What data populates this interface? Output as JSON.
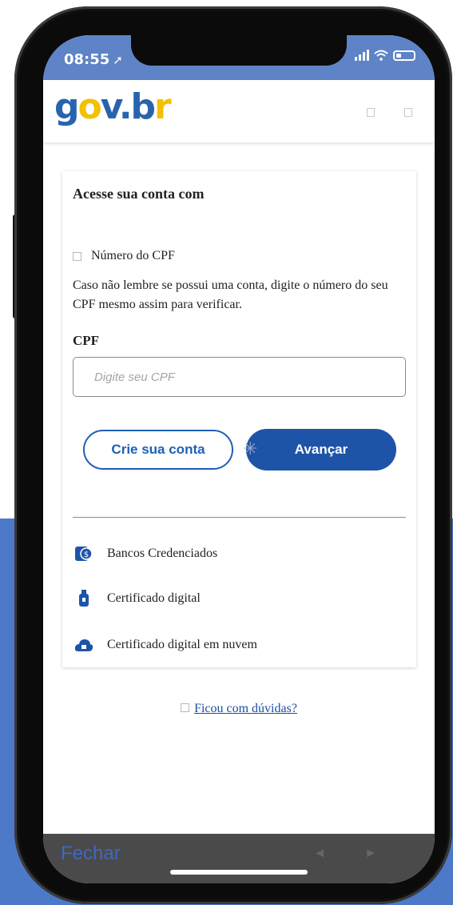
{
  "status_bar": {
    "time": "08:55",
    "location_arrow": "➚"
  },
  "header": {
    "logo_text": "gov.br",
    "icons": [
      "menu-icon",
      "profile-icon"
    ]
  },
  "card": {
    "title": "Acesse sua conta com",
    "option_cpf_label": "Número do CPF",
    "help_text": "Caso não lembre se possui uma conta, digite o número do seu CPF mesmo assim para verificar.",
    "cpf_label": "CPF",
    "cpf_placeholder": "Digite seu CPF",
    "create_button": "Crie sua conta",
    "next_button": "Avançar",
    "other_options": [
      {
        "label": "Bancos Credenciados",
        "icon": "bank-icon"
      },
      {
        "label": "Certificado digital",
        "icon": "usb-token-icon"
      },
      {
        "label": "Certificado digital em nuvem",
        "icon": "cloud-icon"
      }
    ]
  },
  "help": {
    "link_text": "Ficou com dúvidas?"
  },
  "bottom_bar": {
    "close_label": "Fechar",
    "back_arrow": "◄",
    "forward_arrow": "►"
  },
  "colors": {
    "primary": "#1d54a8",
    "status_bar": "#5e83c6",
    "logo_yellow": "#f3c002",
    "logo_blue": "#2864ae",
    "background_blue": "#4d79c9"
  }
}
